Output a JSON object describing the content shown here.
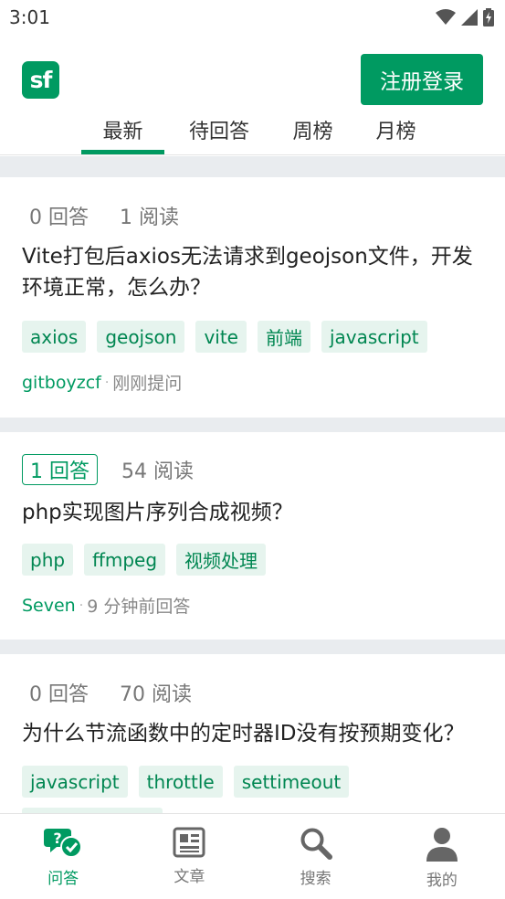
{
  "status_bar": {
    "time": "3:01"
  },
  "header": {
    "logo_text": "sf",
    "signin_label": "注册登录"
  },
  "tabs": [
    {
      "label": "最新",
      "active": true
    },
    {
      "label": "待回答",
      "active": false
    },
    {
      "label": "周榜",
      "active": false
    },
    {
      "label": "月榜",
      "active": false
    }
  ],
  "questions": [
    {
      "answers": "0 回答",
      "views": "1 阅读",
      "answered": false,
      "title": "Vite打包后axios无法请求到geojson文件，开发环境正常，怎么办？",
      "tags": [
        "axios",
        "geojson",
        "vite",
        "前端",
        "javascript"
      ],
      "author": "gitboyzcf",
      "time": "刚刚提问"
    },
    {
      "answers": "1 回答",
      "views": "54 阅读",
      "answered": true,
      "title": "php实现图片序列合成视频？",
      "tags": [
        "php",
        "ffmpeg",
        "视频处理"
      ],
      "author": "Seven",
      "time": "9 分钟前回答"
    },
    {
      "answers": "0 回答",
      "views": "70 阅读",
      "answered": false,
      "title": "为什么节流函数中的定时器ID没有按预期变化？",
      "tags": [
        "javascript",
        "throttle",
        "settimeout"
      ]
    }
  ],
  "bottom_nav": [
    {
      "label": "问答",
      "icon": "qa-icon",
      "active": true
    },
    {
      "label": "文章",
      "icon": "article-icon",
      "active": false
    },
    {
      "label": "搜索",
      "icon": "search-icon",
      "active": false
    },
    {
      "label": "我的",
      "icon": "profile-icon",
      "active": false
    }
  ],
  "colors": {
    "brand": "#009a61",
    "tag_bg": "#e6f4ee",
    "divider": "#e9ecef"
  }
}
